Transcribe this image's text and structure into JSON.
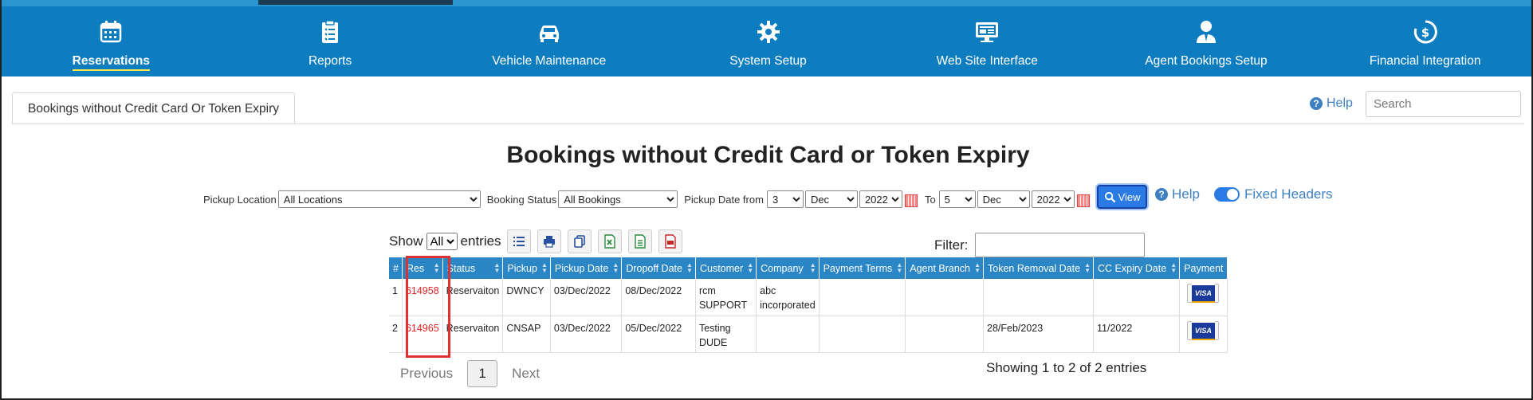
{
  "nav": {
    "items": [
      {
        "label": "Reservations",
        "icon": "calendar-icon",
        "active": true
      },
      {
        "label": "Reports",
        "icon": "clipboard-icon",
        "active": false
      },
      {
        "label": "Vehicle Maintenance",
        "icon": "car-icon",
        "active": false
      },
      {
        "label": "System Setup",
        "icon": "gear-icon",
        "active": false
      },
      {
        "label": "Web Site Interface",
        "icon": "monitor-icon",
        "active": false
      },
      {
        "label": "Agent Bookings Setup",
        "icon": "agent-icon",
        "active": false
      },
      {
        "label": "Financial Integration",
        "icon": "dollar-cycle-icon",
        "active": false
      }
    ]
  },
  "tab": {
    "label": "Bookings without Credit Card Or Token Expiry"
  },
  "header": {
    "help_label": "Help",
    "search_placeholder": "Search"
  },
  "page": {
    "title": "Bookings without Credit Card or Token Expiry"
  },
  "filters": {
    "pickup_location_label": "Pickup Location",
    "pickup_location_value": "All Locations",
    "booking_status_label": "Booking Status",
    "booking_status_value": "All Bookings",
    "pickup_date_from_label": "Pickup Date from",
    "from_day": "3",
    "from_month": "Dec",
    "from_year": "2022",
    "to_label": "To",
    "to_day": "5",
    "to_month": "Dec",
    "to_year": "2022",
    "view_label": "View",
    "help_label": "Help",
    "fixed_headers_label": "Fixed Headers"
  },
  "table_controls": {
    "show_label": "Show",
    "entries_value": "All",
    "entries_label": "entries",
    "filter_label": "Filter:"
  },
  "table": {
    "headers": [
      "#",
      "Res",
      "Status",
      "Pickup",
      "Pickup Date",
      "Dropoff Date",
      "Customer",
      "Company",
      "Payment Terms",
      "Agent Branch",
      "Token Removal Date",
      "CC Expiry Date",
      "Payment"
    ],
    "rows": [
      {
        "num": "1",
        "res": "614958",
        "status": "Reservaiton",
        "pickup": "DWNCY",
        "pickup_date": "03/Dec/2022",
        "dropoff_date": "08/Dec/2022",
        "customer": "rcm SUPPORT",
        "company": "abc incorporated",
        "payment_terms": "",
        "agent_branch": "",
        "token_removal_date": "",
        "cc_expiry_date": "",
        "payment": "VISA"
      },
      {
        "num": "2",
        "res": "614965",
        "status": "Reservaiton",
        "pickup": "CNSAP",
        "pickup_date": "03/Dec/2022",
        "dropoff_date": "05/Dec/2022",
        "customer": "Testing DUDE",
        "company": "",
        "payment_terms": "",
        "agent_branch": "",
        "token_removal_date": "28/Feb/2023",
        "cc_expiry_date": "11/2022",
        "payment": "VISA"
      }
    ]
  },
  "pager": {
    "previous": "Previous",
    "current": "1",
    "next": "Next",
    "showing": "Showing 1 to 2 of 2 entries"
  },
  "colors": {
    "nav_bg": "#0d7dc0",
    "header_bg": "#2b86c6",
    "res_link": "#e52222",
    "highlight_box": "#e03030"
  }
}
